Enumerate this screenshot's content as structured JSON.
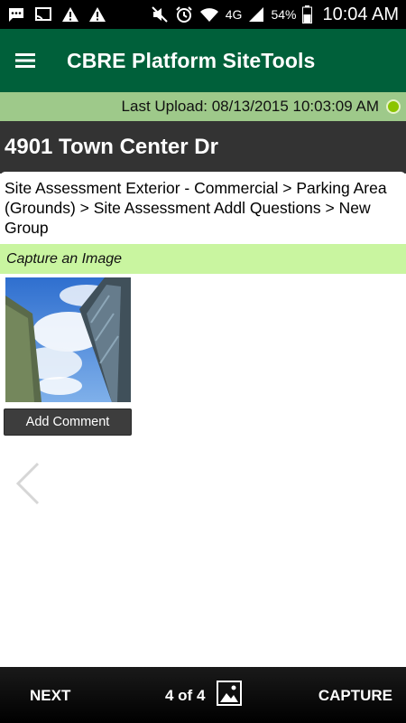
{
  "status_bar": {
    "battery": "54%",
    "time": "10:04 AM",
    "network": "4G",
    "icons": [
      "chat-icon",
      "cast-icon",
      "warning-icon",
      "warning-icon",
      "mute-icon",
      "alarm-icon",
      "wifi-icon",
      "signal-icon",
      "battery-icon"
    ]
  },
  "app_bar": {
    "title": "CBRE Platform SiteTools",
    "menu_icon": "hamburger-menu-icon",
    "color": "#00603a"
  },
  "upload_status": {
    "text": "Last Upload: 08/13/2015 10:03:09 AM",
    "indicator_color": "#8bc400"
  },
  "location": {
    "address": "4901 Town Center Dr"
  },
  "breadcrumb": {
    "text": "Site Assessment Exterior - Commercial > Parking Area (Grounds) > Site Assessment Addl Questions > New Group"
  },
  "capture": {
    "label": "Capture an Image",
    "add_comment_label": "Add Comment",
    "label_color": "#c9f5a0"
  },
  "bottom_bar": {
    "next_label": "NEXT",
    "page_indicator": "4 of 4",
    "capture_label": "CAPTURE",
    "gallery_icon": "gallery-image-icon"
  }
}
